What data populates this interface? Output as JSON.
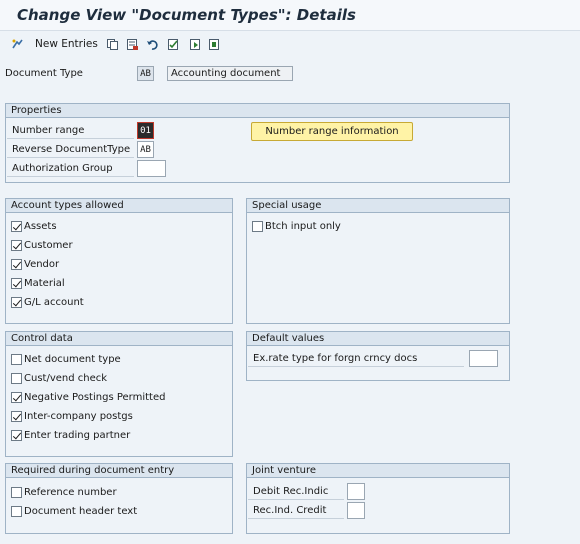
{
  "window": {
    "title": "Change View \"Document Types\": Details"
  },
  "toolbar": {
    "new_entries": "New Entries"
  },
  "header": {
    "doc_type_label": "Document Type",
    "doc_type_value": "AB",
    "doc_type_desc": "Accounting document"
  },
  "properties": {
    "title": "Properties",
    "number_range_label": "Number range",
    "number_range_value": "01",
    "reverse_label": "Reverse DocumentType",
    "reverse_value": "AB",
    "auth_label": "Authorization Group",
    "auth_value": "",
    "nr_info_button": "Number range information"
  },
  "account_types": {
    "title": "Account types allowed",
    "items": [
      {
        "label": "Assets",
        "checked": true
      },
      {
        "label": "Customer",
        "checked": true
      },
      {
        "label": "Vendor",
        "checked": true
      },
      {
        "label": "Material",
        "checked": true
      },
      {
        "label": "G/L account",
        "checked": true
      }
    ]
  },
  "special_usage": {
    "title": "Special usage",
    "items": [
      {
        "label": "Btch input only",
        "checked": false
      }
    ]
  },
  "control_data": {
    "title": "Control data",
    "items": [
      {
        "label": "Net document type",
        "checked": false
      },
      {
        "label": "Cust/vend check",
        "checked": false
      },
      {
        "label": "Negative Postings Permitted",
        "checked": true
      },
      {
        "label": "Inter-company postgs",
        "checked": true
      },
      {
        "label": "Enter trading partner",
        "checked": true
      }
    ]
  },
  "default_values": {
    "title": "Default values",
    "ex_rate_label": "Ex.rate type for forgn crncy docs",
    "ex_rate_value": ""
  },
  "required_entry": {
    "title": "Required during document entry",
    "items": [
      {
        "label": "Reference number",
        "checked": false
      },
      {
        "label": "Document header text",
        "checked": false
      }
    ]
  },
  "joint_venture": {
    "title": "Joint venture",
    "debit_label": "Debit Rec.Indic",
    "debit_value": "",
    "credit_label": "Rec.Ind. Credit",
    "credit_value": ""
  }
}
